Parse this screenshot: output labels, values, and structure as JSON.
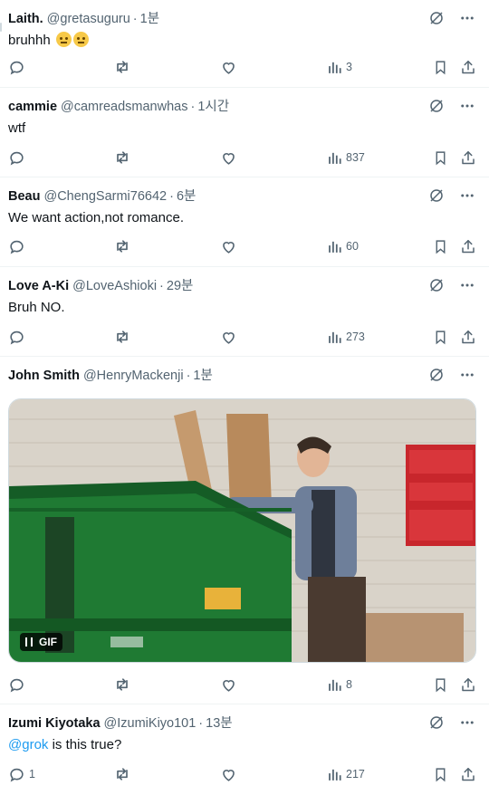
{
  "tweets": [
    {
      "name": "Laith.",
      "handle": "@gretasuguru",
      "time": "1분",
      "text": "bruhhh",
      "emoji_count": 2,
      "stats": {
        "replies": "",
        "views": "3"
      }
    },
    {
      "name": "cammie",
      "handle": "@camreadsmanwhas",
      "time": "1시간",
      "text": "wtf",
      "stats": {
        "replies": "",
        "views": "837"
      }
    },
    {
      "name": "Beau",
      "handle": "@ChengSarmi76642",
      "time": "6분",
      "text": "We want action,not romance.",
      "stats": {
        "replies": "",
        "views": "60"
      }
    },
    {
      "name": "Love A-Ki",
      "handle": "@LoveAshioki",
      "time": "29분",
      "text": "Bruh NO.",
      "stats": {
        "replies": "",
        "views": "273"
      }
    },
    {
      "name": "John Smith",
      "handle": "@HenryMackenji",
      "time": "1분",
      "text": "",
      "media": {
        "type": "gif",
        "badge": "GIF"
      },
      "stats": {
        "replies": "",
        "views": "8"
      }
    },
    {
      "name": "Izumi Kiyotaka",
      "handle": "@IzumiKiyo101",
      "time": "13분",
      "mention": "@grok",
      "text": " is this true?",
      "stats": {
        "replies": "1",
        "views": "217"
      }
    }
  ],
  "separator": "·",
  "colors": {
    "text": "#0f1419",
    "secondary": "#536471",
    "link": "#1d9bf0",
    "divider": "#eff3f4"
  },
  "icons": [
    "grok-icon",
    "more-icon",
    "reply-icon",
    "retweet-icon",
    "like-icon",
    "views-icon",
    "bookmark-icon",
    "share-icon",
    "pause-icon"
  ]
}
